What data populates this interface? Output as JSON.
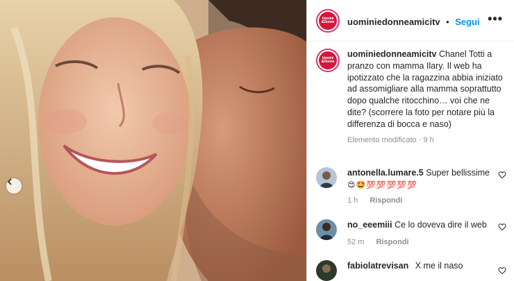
{
  "account": {
    "username": "uominiedonneamicitv",
    "follow_label": "Segui",
    "separator": "•",
    "more_label": "•••",
    "logo_line1": "Uomini",
    "logo_line2": "&Donne"
  },
  "caption": {
    "username": "uominiedonneamicitv",
    "text": "Chanel Totti a pranzo con mamma Ilary. Il web ha ipotizzato che la ragazzina abbia iniziato ad assomigliare alla mamma soprattutto dopo qualche ritocchino… voi che ne dite? (scorrere la foto per notare più la differenza di bocca e naso)",
    "edited": "Elemento modificato",
    "separator": "·",
    "time": "9 h"
  },
  "comments": [
    {
      "username": "antonella.lumare.5",
      "text": "Super bellissime",
      "emoji": "😍🤩💯💯💯💯💯",
      "time": "1 h",
      "reply_label": "Rispondi"
    },
    {
      "username": "no_eeemiii",
      "text": "Ce lo doveva dire il web",
      "time": "52 m",
      "reply_label": "Rispondi"
    },
    {
      "username": "fabiolatrevisan",
      "text": "X me il naso"
    }
  ],
  "colors": {
    "accent": "#0095f6",
    "brand": "#d2183c",
    "muted": "#8e8e8e",
    "text": "#262626"
  },
  "icons": {
    "carousel_prev": "chevron-left-icon",
    "like": "heart-outline-icon",
    "more": "more-options-icon"
  }
}
